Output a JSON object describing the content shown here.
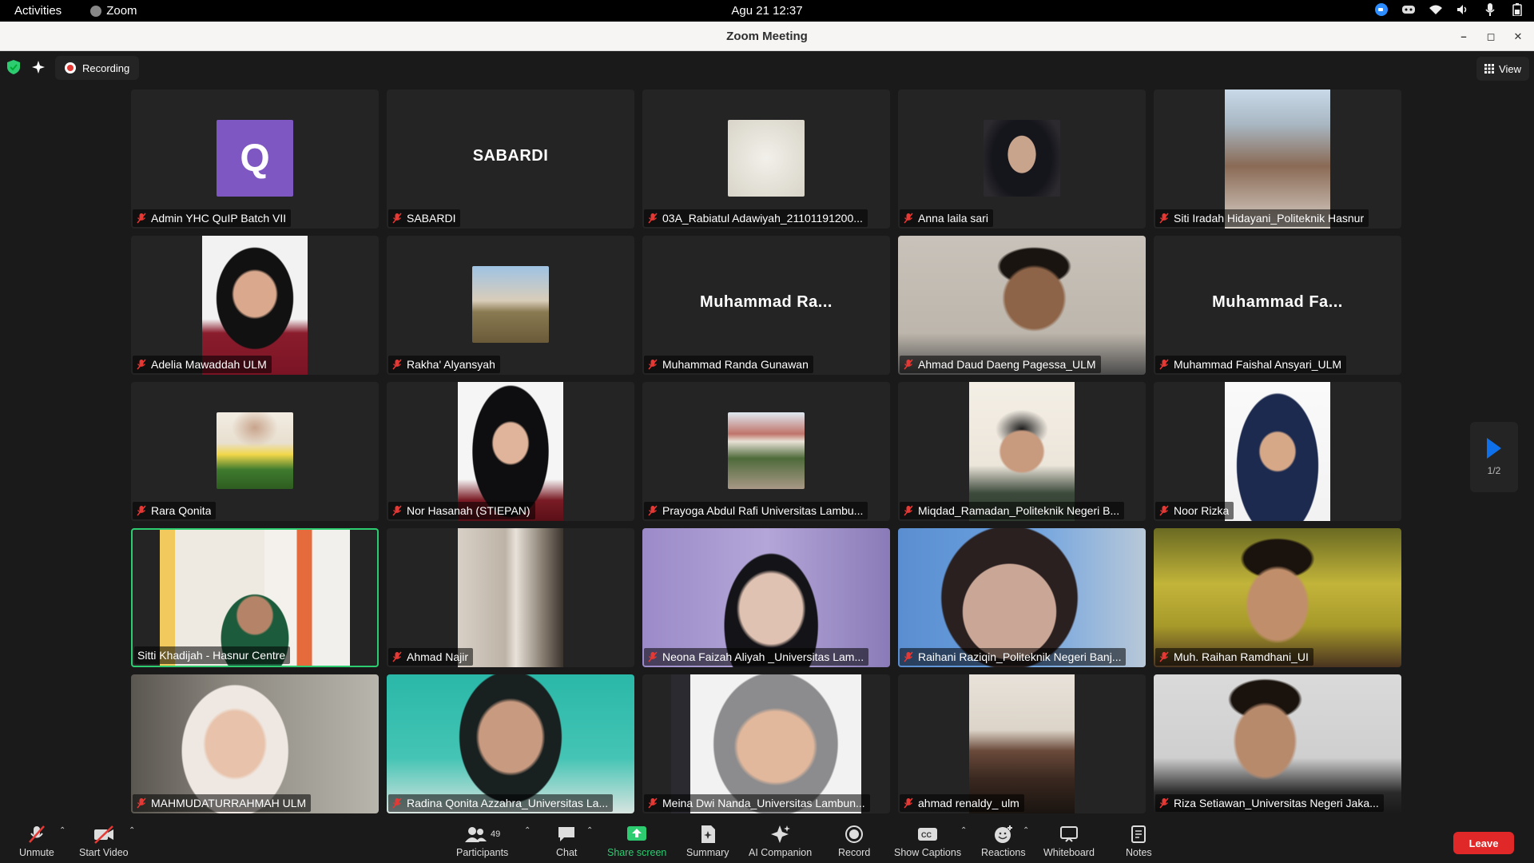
{
  "system_bar": {
    "activities": "Activities",
    "app_name": "Zoom",
    "clock": "Agu 21  12:37"
  },
  "window": {
    "title": "Zoom Meeting",
    "controls": [
      "minimize",
      "restore",
      "close"
    ]
  },
  "meeting_top": {
    "recording_label": "Recording",
    "view_label": "View"
  },
  "pagination": {
    "page_label": "1/2"
  },
  "participants": [
    {
      "name": "Admin YHC QuIP Batch VII",
      "kind": "letter",
      "letter": "Q",
      "muted": true
    },
    {
      "name": "SABARDI",
      "kind": "bigname",
      "big": "SABARDI",
      "muted": true
    },
    {
      "name": "03A_Rabiatul Adawiyah_21101191200...",
      "kind": "avatar",
      "art": "calligraphy",
      "muted": true
    },
    {
      "name": "Anna laila sari",
      "kind": "avatar",
      "art": "hijab-dark",
      "muted": true
    },
    {
      "name": "Siti Iradah Hidayani_Politeknik Hasnur",
      "kind": "portrait",
      "art": "girl-bed",
      "muted": true
    },
    {
      "name": "Adelia Mawaddah ULM",
      "kind": "portrait",
      "art": "hijab-maroon",
      "muted": true
    },
    {
      "name": "Rakha' Alyansyah",
      "kind": "avatar",
      "art": "mountain",
      "muted": true
    },
    {
      "name": "Muhammad Randa Gunawan",
      "kind": "bigname",
      "big": "Muhammad Ra...",
      "muted": true
    },
    {
      "name": "Ahmad Daud Daeng Pagessa_ULM",
      "kind": "full",
      "art": "boy-wall",
      "muted": true
    },
    {
      "name": "Muhammad Faishal Ansyari_ULM",
      "kind": "bigname",
      "big": "Muhammad Fa...",
      "muted": true
    },
    {
      "name": "Rara Qonita",
      "kind": "avatar",
      "art": "tulips",
      "muted": true
    },
    {
      "name": "Nor Hasanah (STIEPAN)",
      "kind": "portrait",
      "art": "hijab-black",
      "muted": true
    },
    {
      "name": "Prayoga Abdul Rafi Universitas Lambu...",
      "kind": "avatar",
      "art": "outdoor",
      "muted": true
    },
    {
      "name": "Miqdad_Ramadan_Politeknik Negeri B...",
      "kind": "portrait",
      "art": "boy-glasses",
      "muted": true
    },
    {
      "name": "Noor Rizka",
      "kind": "portrait",
      "art": "hijab-navy",
      "muted": true
    },
    {
      "name": "Sitti Khadijah - Hasnur Centre",
      "kind": "portrait-wide",
      "art": "teacher",
      "muted": false,
      "active": true
    },
    {
      "name": "Ahmad Najir",
      "kind": "portrait",
      "art": "blurry",
      "muted": true
    },
    {
      "name": "Neona Faizah Aliyah _Universitas Lam...",
      "kind": "full",
      "art": "purple-glasses",
      "muted": true
    },
    {
      "name": "Raihani Raziqin_Politeknik Negeri Banj...",
      "kind": "full",
      "art": "blue-glasses",
      "muted": true
    },
    {
      "name": "Muh. Raihan Ramdhani_UI",
      "kind": "full",
      "art": "boy-yellow",
      "muted": true
    },
    {
      "name": "MAHMUDATURRAHMAH ULM",
      "kind": "full",
      "art": "hijab-white",
      "muted": true
    },
    {
      "name": "Radina Qonita Azzahra_Universitas La...",
      "kind": "full",
      "art": "teal-hijab",
      "muted": true
    },
    {
      "name": "Meina Dwi Nanda_Universitas Lambun...",
      "kind": "portrait-wide",
      "art": "hijab-gray",
      "muted": true
    },
    {
      "name": "ahmad renaldy_ ulm",
      "kind": "portrait",
      "art": "dark-room",
      "muted": true
    },
    {
      "name": "Riza Setiawan_Universitas Negeri Jaka...",
      "kind": "full",
      "art": "boy-room",
      "muted": true
    }
  ],
  "toolbar": {
    "unmute": "Unmute",
    "start_video": "Start Video",
    "participants": "Participants",
    "participants_count": "49",
    "chat": "Chat",
    "share_screen": "Share screen",
    "summary": "Summary",
    "ai_companion": "AI Companion",
    "record": "Record",
    "show_captions": "Show Captions",
    "reactions": "Reactions",
    "whiteboard": "Whiteboard",
    "notes": "Notes",
    "leave": "Leave"
  },
  "colors": {
    "leave": "#e02828",
    "share_green": "#2ecc71",
    "active_border": "#2ecc71",
    "muted_red": "#e53935",
    "avatar_purple": "#7e57c2"
  }
}
